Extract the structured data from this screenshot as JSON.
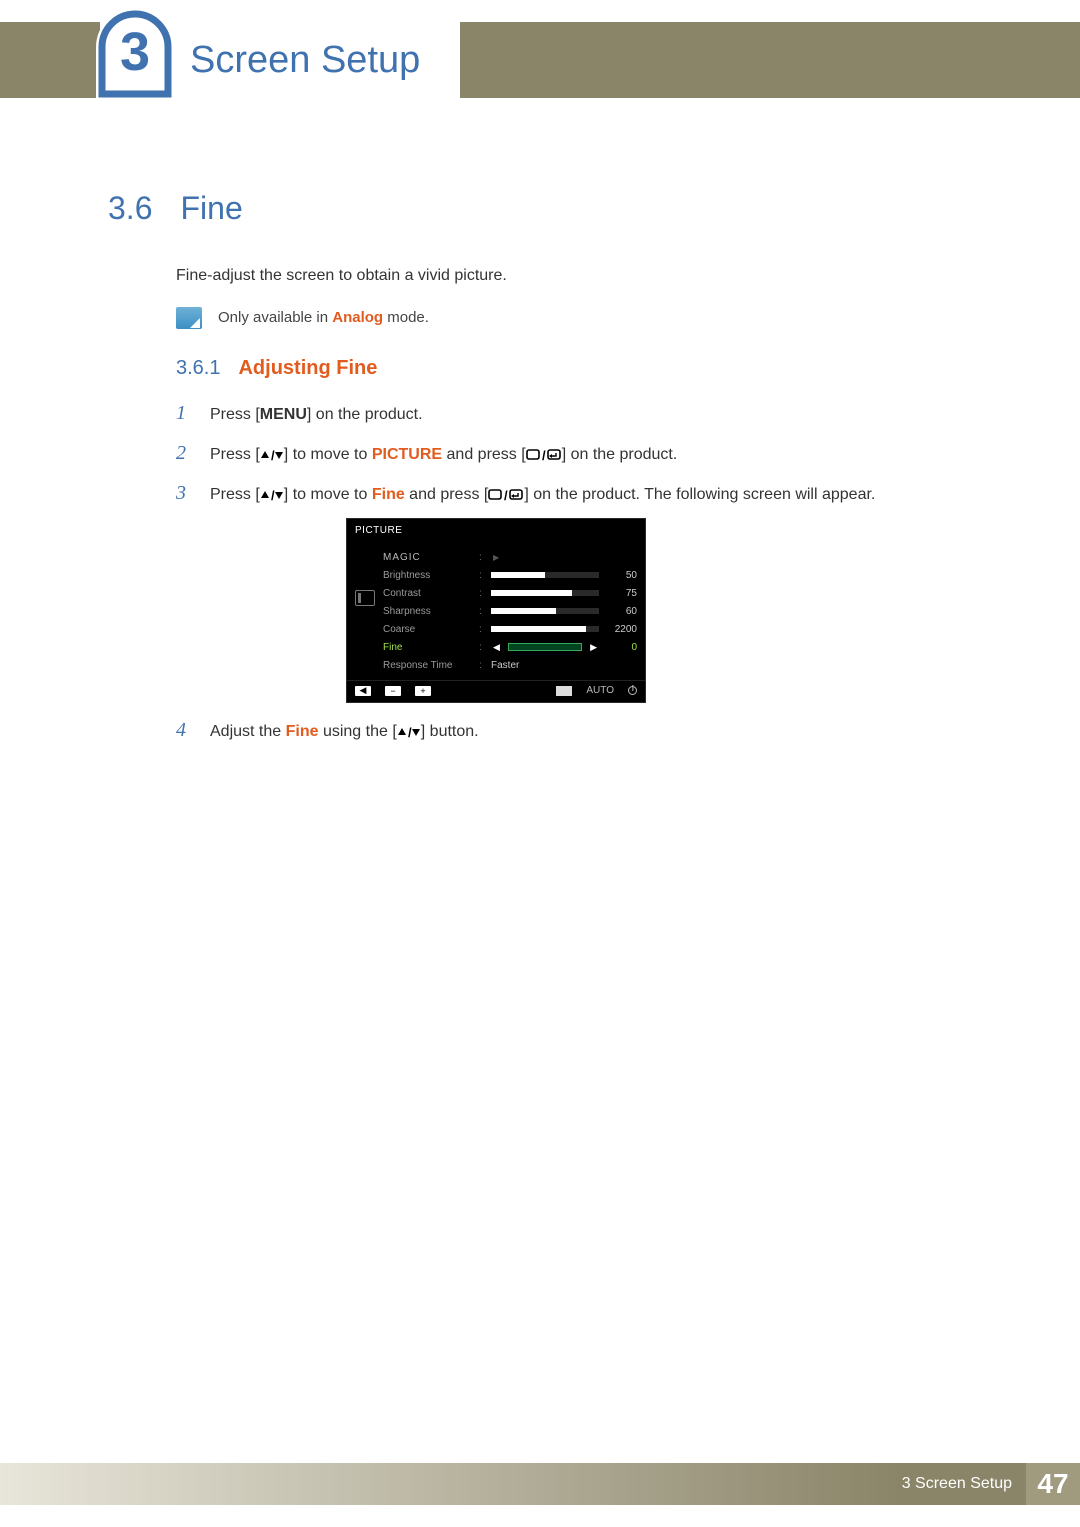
{
  "chapter": {
    "number": "3",
    "title": "Screen Setup"
  },
  "section": {
    "number": "3.6",
    "title": "Fine"
  },
  "intro": "Fine-adjust the screen to obtain a vivid picture.",
  "note": {
    "prefix": "Only available in ",
    "mode": "Analog",
    "suffix": " mode."
  },
  "subsection": {
    "number": "3.6.1",
    "title": "Adjusting Fine"
  },
  "steps": {
    "s1": {
      "num": "1",
      "a": "Press [",
      "menu": "MENU",
      "b": "] on the product."
    },
    "s2": {
      "num": "2",
      "a": "Press [",
      "b": "] to move to ",
      "picture": "PICTURE",
      "c": " and press [",
      "d": "] on the product."
    },
    "s3": {
      "num": "3",
      "a": "Press [",
      "b": "] to move to ",
      "fine": "Fine",
      "c": " and press [",
      "d": "] on the product. The following screen will appear."
    },
    "s4": {
      "num": "4",
      "a": "Adjust the ",
      "fine": "Fine",
      "b": " using the [",
      "c": "] button."
    }
  },
  "osd": {
    "title": "PICTURE",
    "items": [
      {
        "label": "MAGIC",
        "type": "menu"
      },
      {
        "label": "Brightness",
        "type": "bar",
        "value": 50,
        "max": 100
      },
      {
        "label": "Contrast",
        "type": "bar",
        "value": 75,
        "max": 100
      },
      {
        "label": "Sharpness",
        "type": "bar",
        "value": 60,
        "max": 100
      },
      {
        "label": "Coarse",
        "type": "bar",
        "value": 2200,
        "max": 2500
      },
      {
        "label": "Fine",
        "type": "bar",
        "value": 0,
        "max": 100,
        "active": true
      },
      {
        "label": "Response Time",
        "type": "select",
        "text": "Faster"
      }
    ],
    "footer": {
      "auto": "AUTO"
    }
  },
  "footer": {
    "text": "3 Screen Setup",
    "page": "47"
  }
}
